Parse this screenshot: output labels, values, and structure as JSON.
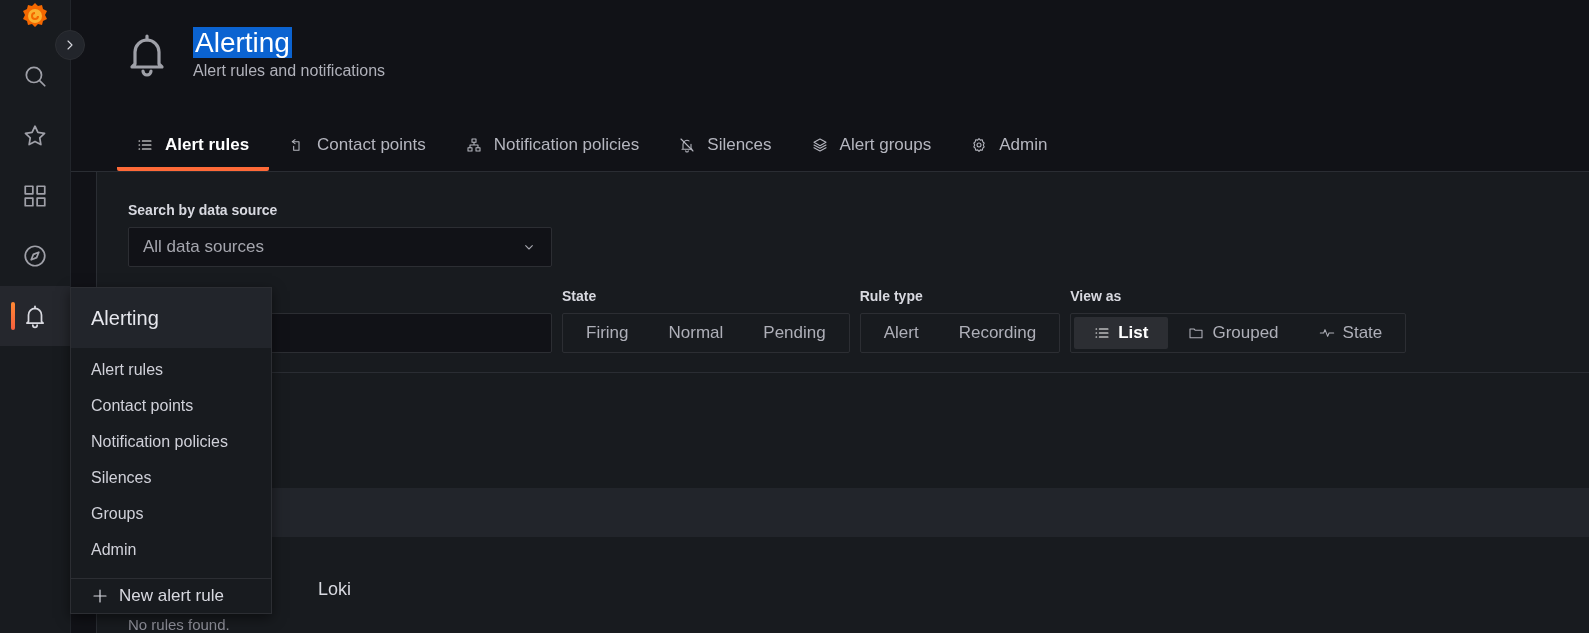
{
  "sidebar": {
    "items": [
      {
        "kind": "search",
        "selected": false
      },
      {
        "kind": "star",
        "selected": false
      },
      {
        "kind": "grid",
        "selected": false
      },
      {
        "kind": "compass",
        "selected": false
      },
      {
        "kind": "bell",
        "selected": true
      }
    ]
  },
  "header": {
    "title": "Alerting",
    "title_selected": true,
    "subtitle": "Alert rules and notifications"
  },
  "tabs": [
    {
      "label": "Alert rules",
      "kind": "list",
      "selected": true
    },
    {
      "label": "Contact points",
      "kind": "contact",
      "selected": false
    },
    {
      "label": "Notification policies",
      "kind": "tree",
      "selected": false
    },
    {
      "label": "Silences",
      "kind": "bell-off",
      "selected": false
    },
    {
      "label": "Alert groups",
      "kind": "layers",
      "selected": false
    },
    {
      "label": "Admin",
      "kind": "gear",
      "selected": false
    }
  ],
  "filters": {
    "datasource": {
      "label": "Search by data source",
      "placeholder": "All data sources"
    },
    "state": {
      "label": "State",
      "options": [
        {
          "label": "Firing",
          "selected": false
        },
        {
          "label": "Normal",
          "selected": false
        },
        {
          "label": "Pending",
          "selected": false
        }
      ]
    },
    "rule_type": {
      "label": "Rule type",
      "options": [
        {
          "label": "Alert",
          "selected": false
        },
        {
          "label": "Recording",
          "selected": false
        }
      ]
    },
    "view_as": {
      "label": "View as",
      "options": [
        {
          "label": "List",
          "kind": "list",
          "selected": true
        },
        {
          "label": "Grouped",
          "kind": "folder",
          "selected": false
        },
        {
          "label": "State",
          "kind": "pulse",
          "selected": false
        }
      ]
    }
  },
  "rules": {
    "source": "Loki",
    "message": "No rules found."
  },
  "menu": {
    "title": "Alerting",
    "items": [
      "Alert rules",
      "Contact points",
      "Notification policies",
      "Silences",
      "Groups",
      "Admin"
    ],
    "action": "New alert rule"
  }
}
